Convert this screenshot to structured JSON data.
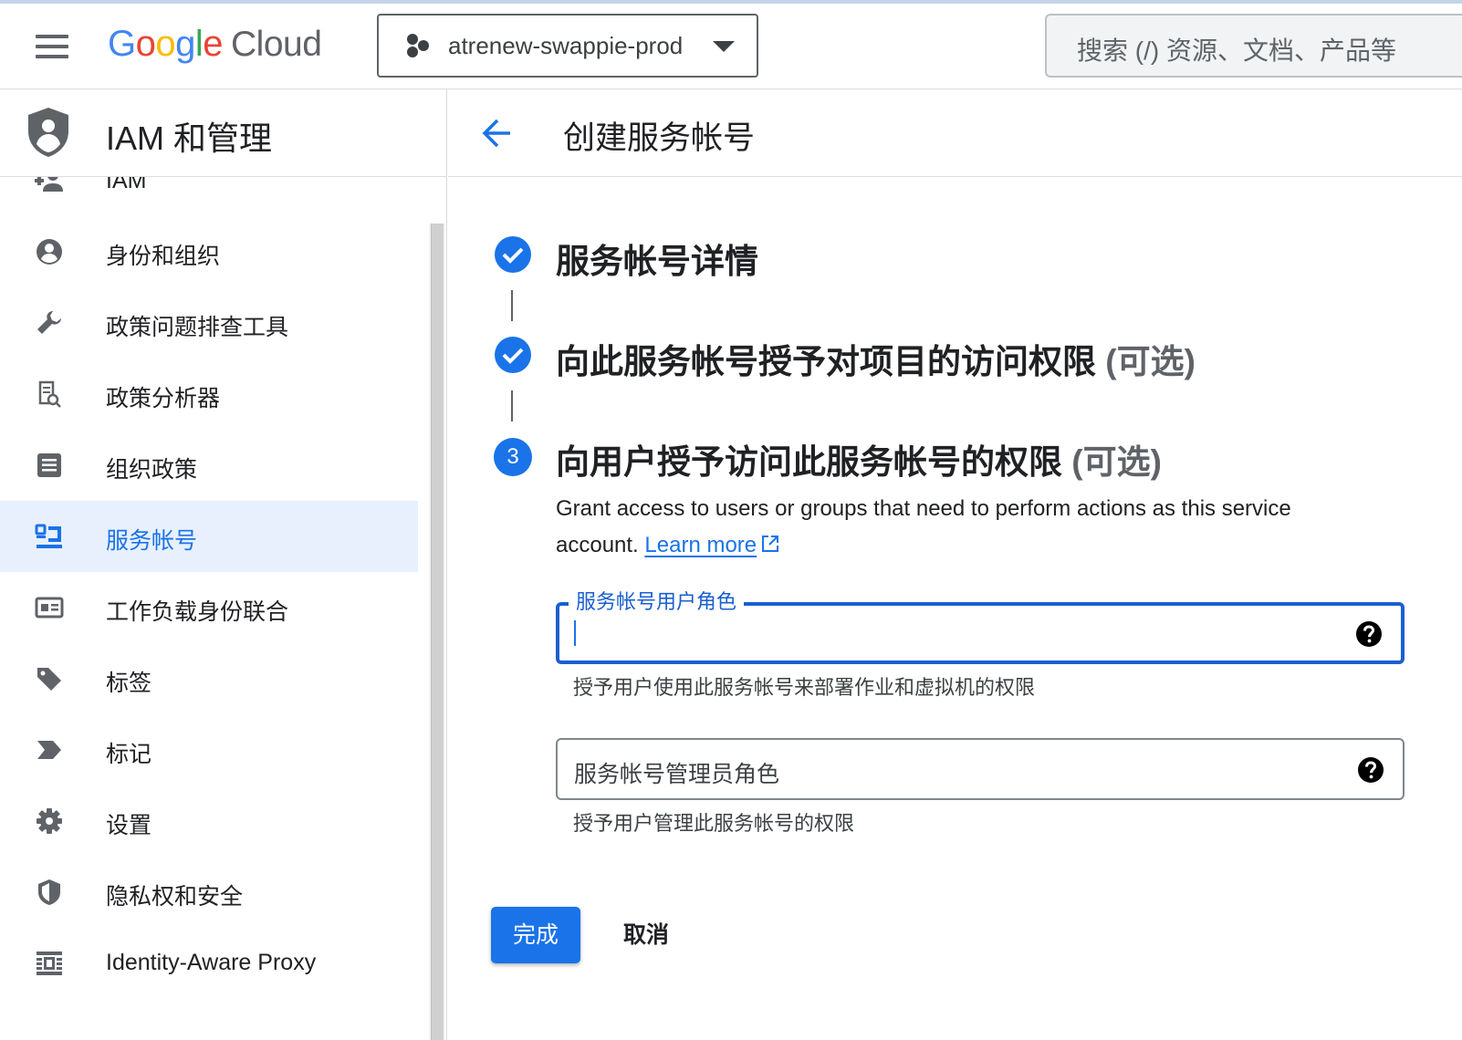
{
  "topbar": {
    "logo": {
      "g1": "G",
      "o1": "o",
      "o2": "o",
      "g2": "g",
      "l": "l",
      "e": "e",
      "cloud": "Cloud"
    },
    "project_name": "atrenew-swappie-prod",
    "search_placeholder": "搜索 (/) 资源、文档、产品等"
  },
  "sidebar": {
    "title": "IAM 和管理",
    "partial_item": "IAM",
    "items": [
      {
        "label": "身份和组织",
        "icon": "account-circle-icon"
      },
      {
        "label": "政策问题排查工具",
        "icon": "wrench-icon"
      },
      {
        "label": "政策分析器",
        "icon": "policy-analyzer-icon"
      },
      {
        "label": "组织政策",
        "icon": "list-document-icon"
      },
      {
        "label": "服务帐号",
        "icon": "service-account-icon",
        "active": true
      },
      {
        "label": "工作负载身份联合",
        "icon": "id-card-icon"
      },
      {
        "label": "标签",
        "icon": "tag-icon"
      },
      {
        "label": "标记",
        "icon": "label-arrow-icon"
      },
      {
        "label": "设置",
        "icon": "gear-icon"
      },
      {
        "label": "隐私权和安全",
        "icon": "shield-icon"
      },
      {
        "label": "Identity-Aware Proxy",
        "icon": "proxy-icon"
      }
    ]
  },
  "page": {
    "title": "创建服务帐号",
    "steps": [
      {
        "title": "服务帐号详情",
        "optional": "",
        "state": "done"
      },
      {
        "title": "向此服务帐号授予对项目的访问权限",
        "optional": "(可选)",
        "state": "done"
      },
      {
        "number": "3",
        "title": "向用户授予访问此服务帐号的权限",
        "optional": "(可选)",
        "state": "current"
      }
    ],
    "description": "Grant access to users or groups that need to perform actions as this service account.",
    "learn_more": "Learn more",
    "fields": {
      "user_role": {
        "label": "服务帐号用户角色",
        "value": "",
        "hint": "授予用户使用此服务帐号来部署作业和虚拟机的权限"
      },
      "admin_role": {
        "placeholder": "服务帐号管理员角色",
        "hint": "授予用户管理此服务帐号的权限"
      }
    },
    "buttons": {
      "done": "完成",
      "cancel": "取消"
    }
  },
  "colors": {
    "accent": "#1a73e8",
    "active_bg": "#e8f0fe",
    "text": "#202124",
    "secondary": "#5f6368"
  }
}
